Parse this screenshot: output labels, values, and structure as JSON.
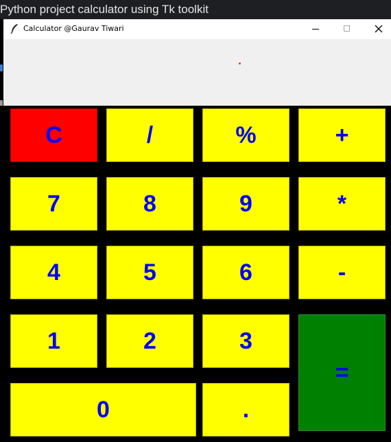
{
  "host": {
    "title": "Python project calculator using Tk toolkit"
  },
  "window": {
    "title": "Calculator @Gaurav Tiwari",
    "icon": "feather-icon",
    "controls": {
      "minimize_icon": "minimize-icon",
      "maximize_icon": "maximize-icon",
      "close_icon": "close-icon"
    }
  },
  "display": {
    "value": ""
  },
  "keys": {
    "clear": "C",
    "divide": "/",
    "percent": "%",
    "plus": "+",
    "seven": "7",
    "eight": "8",
    "nine": "9",
    "multiply": "*",
    "four": "4",
    "five": "5",
    "six": "6",
    "minus": "-",
    "one": "1",
    "two": "2",
    "three": "3",
    "equals": "=",
    "zero": "0",
    "dot": "."
  },
  "colors": {
    "key_background": "#ffff00",
    "key_text": "#0000ff",
    "clear_background": "#ff0000",
    "equals_background": "#008000",
    "display_background": "#f0f0f0",
    "window_background": "#000000"
  }
}
